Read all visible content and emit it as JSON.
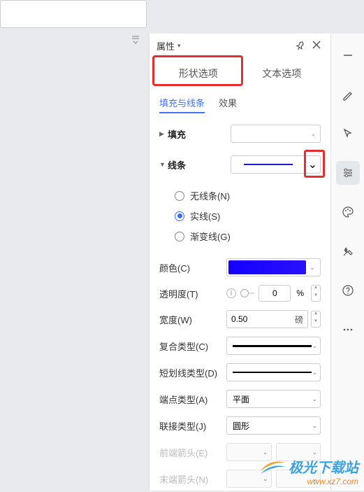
{
  "panel": {
    "title": "属性"
  },
  "tabs": {
    "shape": "形状选项",
    "text": "文本选项"
  },
  "subtabs": {
    "fill_line": "填充与线条",
    "effects": "效果"
  },
  "fill": {
    "label": "填充"
  },
  "line": {
    "label": "线条",
    "options": {
      "none": "无线条(N)",
      "solid": "实线(S)",
      "gradient": "渐变线(G)"
    },
    "color_label": "颜色(C)",
    "color_value": "#1400ff",
    "opacity_label": "透明度(T)",
    "opacity_value": "0",
    "opacity_unit": "%",
    "width_label": "宽度(W)",
    "width_value": "0.50",
    "width_unit": "磅",
    "compound_label": "复合类型(C)",
    "dash_label": "短划线类型(D)",
    "cap_label": "端点类型(A)",
    "cap_value": "平面",
    "join_label": "联接类型(J)",
    "join_value": "圆形",
    "arrow_start_label": "前端箭头(E)",
    "arrow_end_label": "末端箭头(N)"
  },
  "watermark": {
    "top": "极光下载站",
    "bottom": "www.xz7.com"
  }
}
